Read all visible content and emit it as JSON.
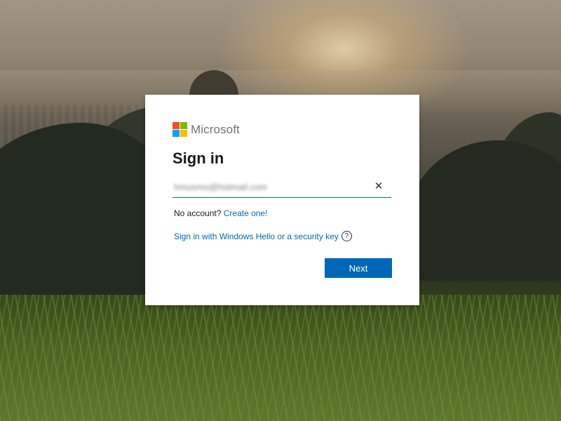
{
  "colors": {
    "accent": "#0067b8",
    "logo_red": "#f25022",
    "logo_green": "#7fba00",
    "logo_blue": "#00a4ef",
    "logo_yellow": "#ffb900"
  },
  "brand": {
    "name": "Microsoft"
  },
  "signin": {
    "title": "Sign in",
    "email_value": "hmusmo@hotmail.com",
    "clear_symbol": "✕",
    "no_account_text": "No account?",
    "create_link": "Create one!",
    "hello_link": "Sign in with Windows Hello or a security key",
    "help_symbol": "?",
    "next_label": "Next"
  },
  "icons": {
    "logo": "microsoft-logo-icon",
    "clear": "close-icon",
    "help": "question-circle-icon"
  }
}
